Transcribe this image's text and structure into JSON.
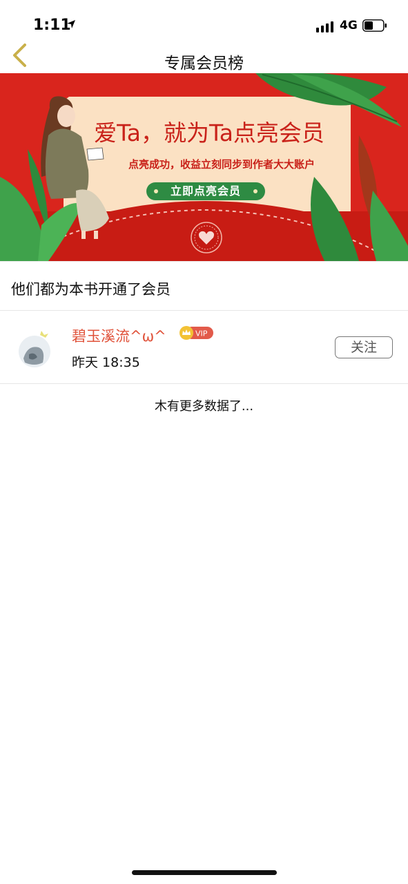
{
  "status": {
    "time": "1:11",
    "network": "4G"
  },
  "nav": {
    "title": "专属会员榜"
  },
  "banner": {
    "headline": "爱Ta，就为Ta点亮会员",
    "subline": "点亮成功，收益立刻同步到作者大大账户",
    "cta_label": "立即点亮会员",
    "colors": {
      "bg": "#d9251d",
      "card": "#fbe1c3",
      "cta": "#2e8b43"
    }
  },
  "section": {
    "heading": "他们都为本书开通了会员"
  },
  "members": [
    {
      "name": "碧玉溪流^ω^",
      "badge": "VIP",
      "time": "昨天 18:35",
      "follow_label": "关注"
    }
  ],
  "footer": {
    "no_more": "木有更多数据了..."
  },
  "colors": {
    "accent": "#e0523a",
    "back_arrow": "#c9b04a"
  }
}
